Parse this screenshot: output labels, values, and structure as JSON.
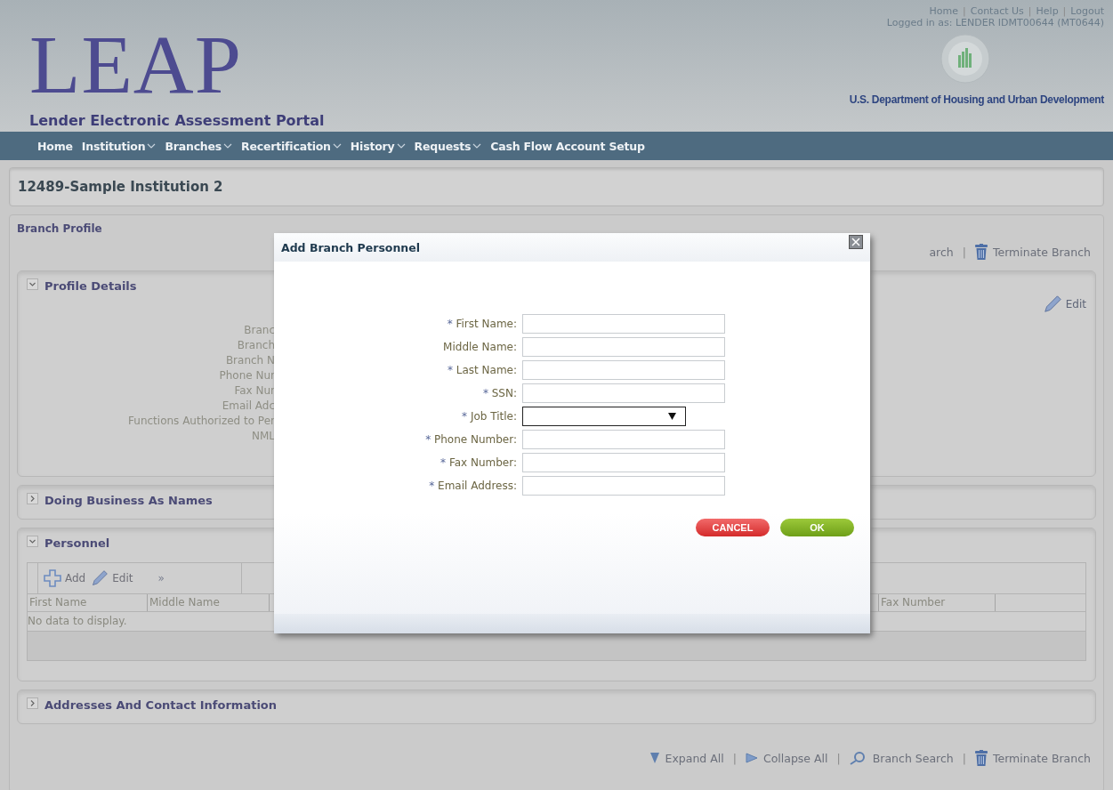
{
  "header": {
    "logo": "LEAP",
    "subtitle": "Lender Electronic Assessment Portal",
    "links": [
      "Home",
      "Contact Us",
      "Help",
      "Logout"
    ],
    "separator": "|",
    "login": "Logged in as: LENDER IDMT00644 (MT0644)",
    "agency": "U.S. Department of Housing and Urban Development"
  },
  "nav": [
    {
      "label": "Home",
      "dropdown": false
    },
    {
      "label": "Institution",
      "dropdown": true
    },
    {
      "label": "Branches",
      "dropdown": true
    },
    {
      "label": "Recertification",
      "dropdown": true
    },
    {
      "label": "History",
      "dropdown": true
    },
    {
      "label": "Requests",
      "dropdown": true
    },
    {
      "label": "Cash Flow Account Setup",
      "dropdown": false
    }
  ],
  "institution": "12489-Sample Institution 2",
  "branch_profile": {
    "title": "Branch Profile",
    "separator": "|",
    "top_actions": [
      {
        "label": "arch",
        "kind": "text"
      },
      {
        "label": "Terminate Branch",
        "kind": "trash"
      }
    ],
    "sections": [
      {
        "title": "Profile Details",
        "expanded": true,
        "kind": "details",
        "edit": "Edit",
        "labels": [
          "Branc",
          "Branch",
          "Branch N",
          "Phone Nur",
          "Fax Nur",
          "Email Adc",
          "Functions Authorized to Per",
          "NML"
        ]
      },
      {
        "title": "Doing Business As Names",
        "expanded": false,
        "kind": "empty"
      },
      {
        "title": "Personnel",
        "expanded": true,
        "kind": "table",
        "toolbar": {
          "add": "Add",
          "edit": "Edit",
          "more": "»"
        },
        "columns": [
          "First Name",
          "Middle Name",
          "Fax Number"
        ],
        "empty": "No data to display."
      },
      {
        "title": "Addresses And Contact Information",
        "expanded": false,
        "kind": "empty"
      }
    ],
    "bottom_actions": [
      {
        "label": "Expand All",
        "kind": "expand"
      },
      {
        "label": "Collapse All",
        "kind": "collapse"
      },
      {
        "label": "Branch Search",
        "kind": "search"
      },
      {
        "label": "Terminate Branch",
        "kind": "trash"
      }
    ]
  },
  "dialog": {
    "title": "Add Branch Personnel",
    "fields": [
      {
        "label": "First Name:",
        "required": true,
        "kind": "text"
      },
      {
        "label": "Middle Name:",
        "required": false,
        "kind": "text"
      },
      {
        "label": "Last Name:",
        "required": true,
        "kind": "text"
      },
      {
        "label": "SSN:",
        "required": true,
        "kind": "text"
      },
      {
        "label": "Job Title:",
        "required": true,
        "kind": "select"
      },
      {
        "label": "Phone Number:",
        "required": true,
        "kind": "text"
      },
      {
        "label": "Fax Number:",
        "required": true,
        "kind": "text"
      },
      {
        "label": "Email Address:",
        "required": true,
        "kind": "text"
      }
    ],
    "required_mark": "*",
    "cancel": "CANCEL",
    "ok": "OK"
  }
}
